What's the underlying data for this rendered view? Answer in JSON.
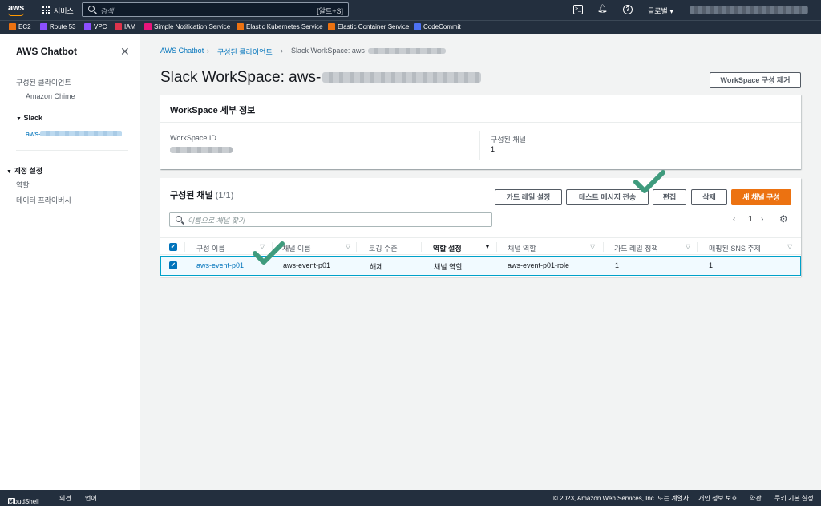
{
  "topnav": {
    "logo": "aws",
    "services_label": "서비스",
    "search_placeholder": "검색",
    "search_shortcut": "[알트+S]",
    "region_label": "글로벌 ▾"
  },
  "favorites": [
    {
      "label": "EC2",
      "color": "#ec7211"
    },
    {
      "label": "Route 53",
      "color": "#8c4fff"
    },
    {
      "label": "VPC",
      "color": "#8c4fff"
    },
    {
      "label": "IAM",
      "color": "#dd344c"
    },
    {
      "label": "Simple Notification Service",
      "color": "#e7157b"
    },
    {
      "label": "Elastic Kubernetes Service",
      "color": "#ec7211"
    },
    {
      "label": "Elastic Container Service",
      "color": "#ec7211"
    },
    {
      "label": "CodeCommit",
      "color": "#4d72f3"
    }
  ],
  "sidebar": {
    "title": "AWS Chatbot",
    "configured_clients": "구성된 클라이언트",
    "amazon_chime": "Amazon Chime",
    "slack": "Slack",
    "workspace_prefix": "aws-",
    "account_settings": "계정 설정",
    "role": "역할",
    "data_privacy": "데이터 프라이버시"
  },
  "breadcrumb": {
    "item1": "AWS Chatbot",
    "item2": "구성된 클라이언트",
    "current": "Slack WorkSpace: aws-"
  },
  "page": {
    "title": "Slack WorkSpace: aws-",
    "remove_button": "WorkSpace 구성 제거"
  },
  "details": {
    "header": "WorkSpace 세부 정보",
    "workspace_id_label": "WorkSpace ID",
    "channels_label": "구성된 채널",
    "channels_value": "1"
  },
  "channels": {
    "header": "구성된 채널",
    "count": "(1/1)",
    "buttons": {
      "guardrail": "가드 레일 설정",
      "test": "테스트 메시지 전송",
      "edit": "편집",
      "delete": "삭제",
      "new": "새 채널 구성"
    },
    "filter_placeholder": "이름으로 채널 찾기",
    "page_number": "1",
    "columns": [
      "구성 이름",
      "채널 이름",
      "로깅 수준",
      "역할 설정",
      "채널 역할",
      "가드 레일 정책",
      "매핑된 SNS 주제"
    ],
    "rows": [
      {
        "config_name": "aws-event-p01",
        "channel_name": "aws-event-p01",
        "logging": "해제",
        "role_setting": "채널 역할",
        "channel_role": "aws-event-p01-role",
        "guardrail_policies": "1",
        "sns_topics": "1"
      }
    ]
  },
  "footer": {
    "cloudshell": "CloudShell",
    "feedback": "의견",
    "language": "언어",
    "copyright": "© 2023, Amazon Web Services, Inc. 또는 계열사.",
    "privacy": "개인 정보 보호",
    "terms": "약관",
    "cookies": "쿠키 기본 설정"
  },
  "colors": {
    "nav_bg": "#232f3e",
    "link": "#0073bb",
    "primary": "#ec7211",
    "selected_row_bg": "#f1faff",
    "annotation_check": "#3f9b7d"
  }
}
